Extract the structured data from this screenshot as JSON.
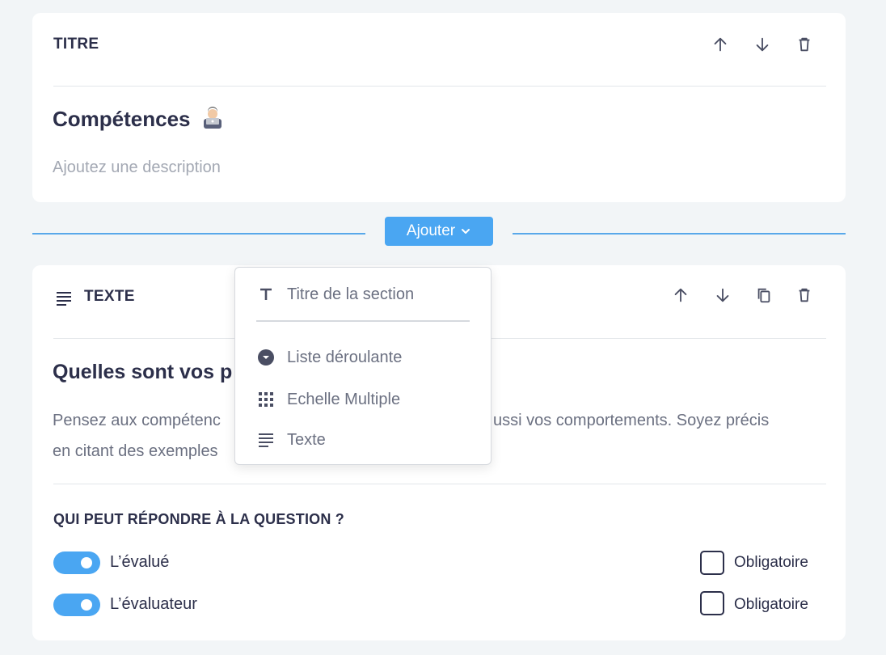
{
  "title_block": {
    "header": "TITRE",
    "heading": "Compétences",
    "heading_emoji": "technologist-emoji",
    "description_placeholder": "Ajoutez une description"
  },
  "add_bar": {
    "button_label": "Ajouter"
  },
  "dropdown_menu": {
    "items": [
      {
        "label": "Titre de la section",
        "icon": "text-format-icon"
      },
      {
        "label": "Liste déroulante",
        "icon": "dropdown-circle-icon"
      },
      {
        "label": "Echelle Multiple",
        "icon": "grid-icon"
      },
      {
        "label": "Texte",
        "icon": "text-lines-icon"
      }
    ]
  },
  "text_block": {
    "header": "TEXTE",
    "question_title": "Quelles sont vos p",
    "description_part1": "Pensez aux compétenc",
    "description_part2": "ussi vos comportements. Soyez précis",
    "description_line2": "en citant des exemples",
    "who_label": "QUI PEUT RÉPONDRE À LA QUESTION ?",
    "respondents": [
      {
        "label": "L’évalué",
        "enabled": true,
        "required_label": "Obligatoire",
        "required": false
      },
      {
        "label": "L’évaluateur",
        "enabled": true,
        "required_label": "Obligatoire",
        "required": false
      }
    ]
  },
  "colors": {
    "accent": "#4aa6f2",
    "text_dark": "#2c2f4a",
    "text_muted": "#6b7081",
    "placeholder": "#a3a8b3",
    "background": "#f2f5f7"
  }
}
